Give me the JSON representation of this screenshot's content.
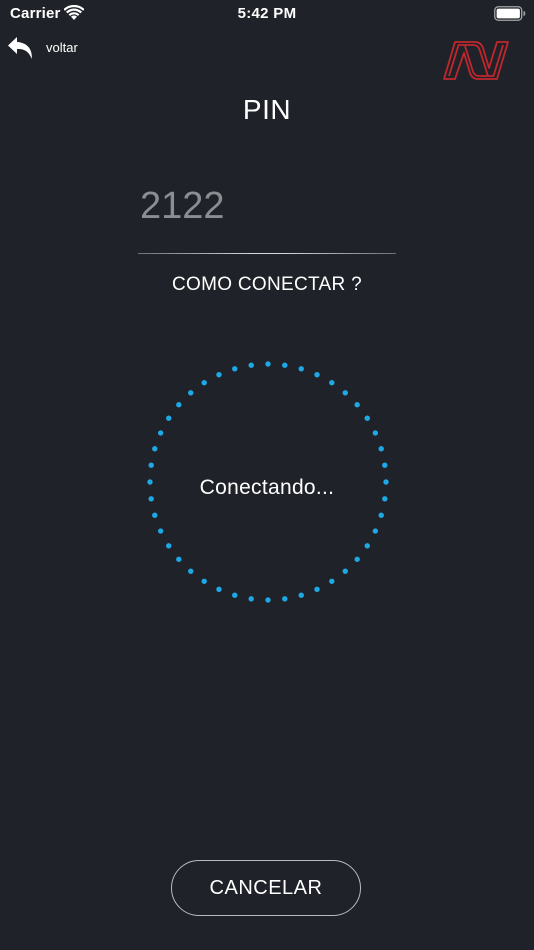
{
  "status_bar": {
    "carrier": "Carrier",
    "time": "5:42 PM",
    "icons": [
      "wifi-icon",
      "battery-icon"
    ]
  },
  "nav": {
    "back_label": "voltar",
    "back_icon": "back-arrow-icon",
    "logo_icon": "brand-logo"
  },
  "pin": {
    "title": "PIN",
    "value": "2122"
  },
  "help_link": "COMO CONECTAR ?",
  "connection": {
    "status": "Conectando..."
  },
  "cancel_label": "CANCELAR",
  "colors": {
    "background": "#1f2228",
    "spinner": "#1ea8e6",
    "logo": "#c1272d",
    "input_text": "#8a8d92"
  }
}
